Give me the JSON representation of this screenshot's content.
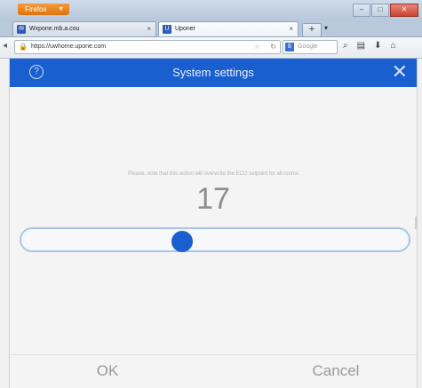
{
  "browser": {
    "app_menu_label": "Firefox",
    "tabs": [
      {
        "label": "Wxpone.mb.a.cou",
        "favicon": "mail-icon"
      },
      {
        "label": "Uponer",
        "favicon": "u-icon"
      }
    ],
    "new_tab_label": "+",
    "url": "https://uwhome.upone.com",
    "search_placeholder": "Google"
  },
  "dialog": {
    "title": "System settings",
    "note": "Please, note that this action will overwrite the ECO setpoint for all rooms",
    "value": "17",
    "slider_fraction": 0.41,
    "ok_label": "OK",
    "cancel_label": "Cancel"
  },
  "colors": {
    "header": "#1a5fd0",
    "thumb": "#1a5fd0",
    "track_border": "#a8c4ee"
  }
}
